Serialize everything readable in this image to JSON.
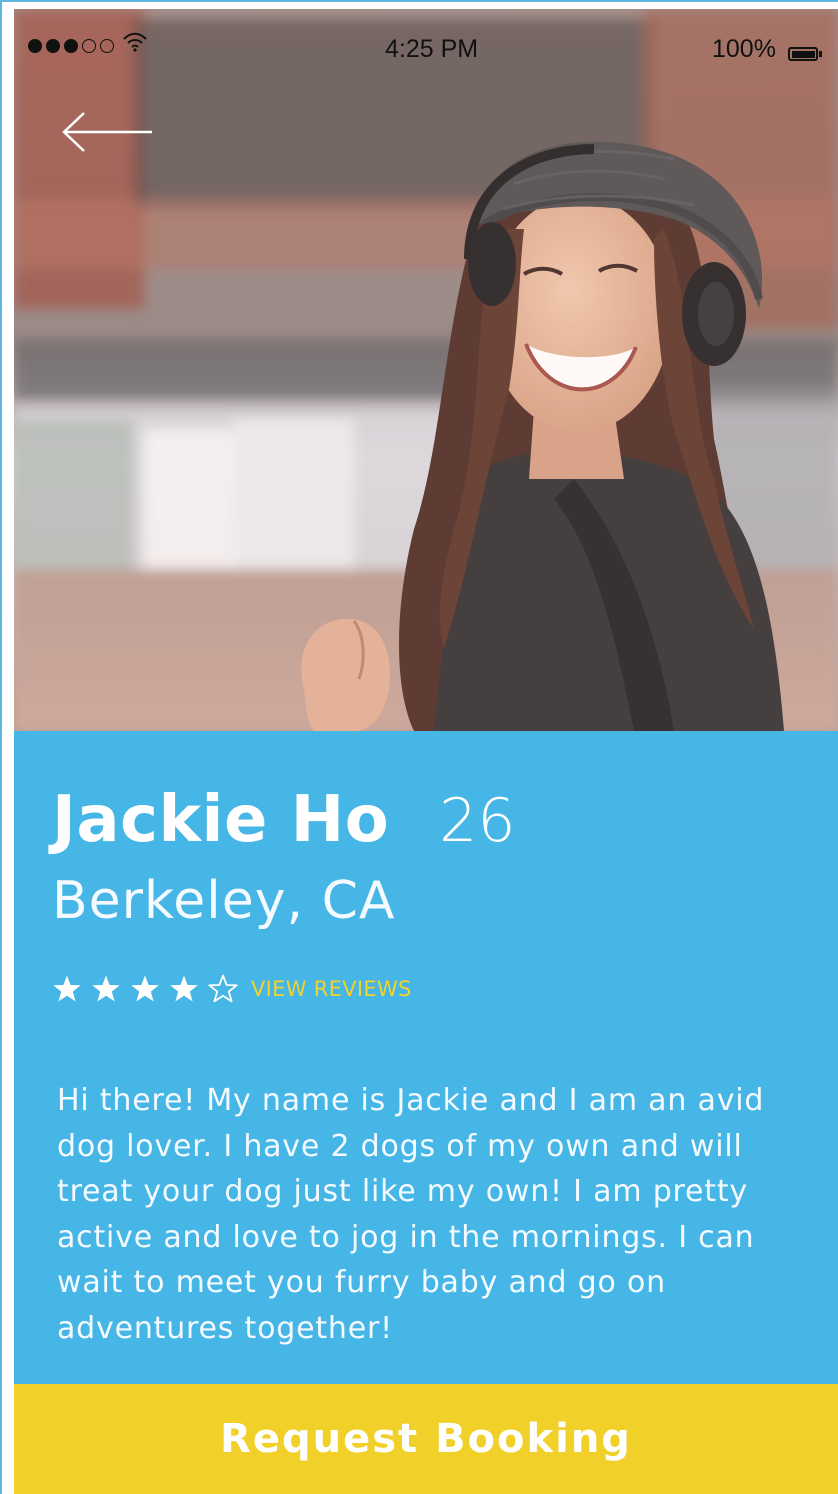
{
  "status_bar": {
    "signal_bars_filled": 3,
    "signal_bars_total": 5,
    "time": "4:25 PM",
    "battery": "100%"
  },
  "navigation": {
    "back_icon": "arrow-left-icon"
  },
  "profile": {
    "photo_icon": "profile-photo",
    "name": "Jackie Ho",
    "age": "26",
    "location": "Berkeley, CA",
    "rating": 4,
    "rating_max": 5,
    "reviews_link": "VIEW REVIEWS",
    "bio": "Hi there! My name is Jackie and I am an avid dog lover. I have 2 dogs of my own and will treat your dog just like my own! I am pretty active and love to jog in the mornings. I can wait to meet you furry baby and go on adventures together!"
  },
  "actions": {
    "booking_label": "Request Booking"
  },
  "colors": {
    "panel": "#45b6e5",
    "accent": "#f2d02a",
    "link": "#f3d22b",
    "text": "#ffffff"
  }
}
